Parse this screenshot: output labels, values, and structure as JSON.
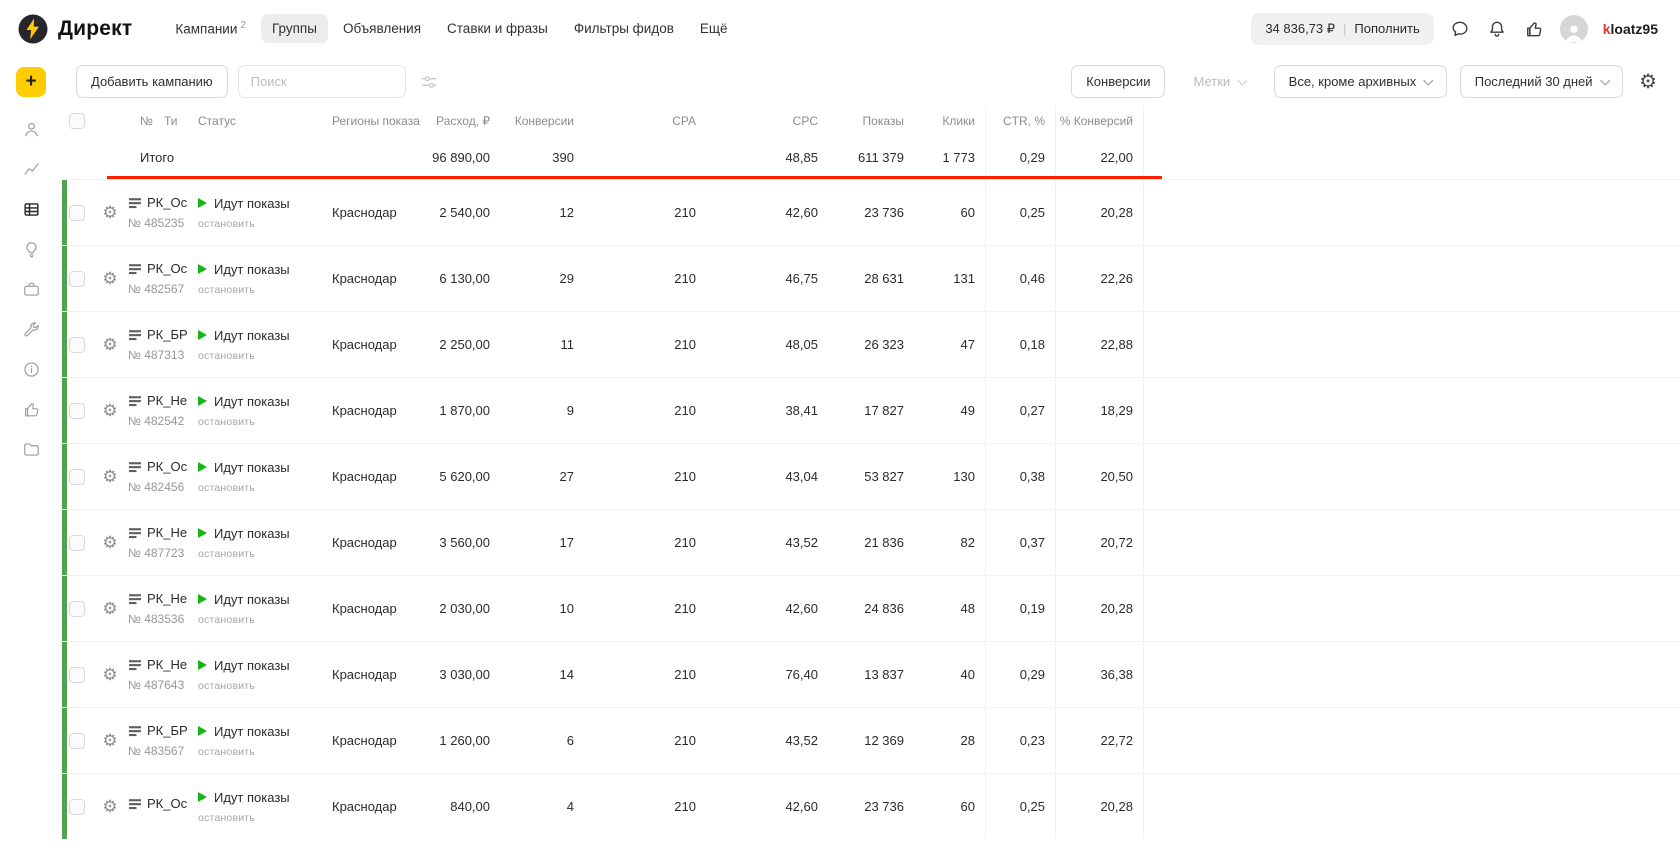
{
  "brand": {
    "app_name": "Директ"
  },
  "header": {
    "nav": [
      {
        "label": "Кампании",
        "badge": "2"
      },
      {
        "label": "Группы"
      },
      {
        "label": "Объявления"
      },
      {
        "label": "Ставки и фразы"
      },
      {
        "label": "Фильтры фидов"
      },
      {
        "label": "Ещё"
      }
    ],
    "balance": "34 836,73 ₽",
    "divider": "|",
    "topup": "Пополнить",
    "username_first": "k",
    "username_rest": "loatz95"
  },
  "sidebar": {
    "add": "+",
    "active_icon": "campaigns"
  },
  "toolbar": {
    "add_campaign": "Добавить кампанию",
    "search_placeholder": "Поиск",
    "conversions": "Конверсии",
    "labels": "Метки",
    "campaign_filter": "Все, кроме архивных",
    "date_range": "Последний 30 дней"
  },
  "table": {
    "headers": {
      "number": "№",
      "type": "Ти",
      "status": "Статус",
      "regions": "Регионы показа",
      "expense": "Расход, ₽",
      "conversions": "Конверсии",
      "cpa": "CPA",
      "cpc": "CPC",
      "shows": "Показы",
      "clicks": "Клики",
      "ctr": "CTR, %",
      "conv_share": "% Конверсий"
    },
    "totals": {
      "label": "Итого",
      "expense": "96 890,00",
      "conversions": "390",
      "cpa": "",
      "cpc": "48,85",
      "shows": "611 379",
      "clicks": "1 773",
      "ctr": "0,29",
      "conv_share": "22,00"
    },
    "rows": [
      {
        "name": "РК_Ос",
        "number": "№ 485235",
        "status": "Идут показы",
        "action": "остановить",
        "region": "Краснодар",
        "expense": "2 540,00",
        "conversions": "12",
        "cpa": "210",
        "cpc": "42,60",
        "shows": "23 736",
        "clicks": "60",
        "ctr": "0,25",
        "conv_share": "20,28"
      },
      {
        "name": "РК_Ос",
        "number": "№ 482567",
        "status": "Идут показы",
        "action": "остановить",
        "region": "Краснодар",
        "expense": "6 130,00",
        "conversions": "29",
        "cpa": "210",
        "cpc": "46,75",
        "shows": "28 631",
        "clicks": "131",
        "ctr": "0,46",
        "conv_share": "22,26"
      },
      {
        "name": "РК_БР",
        "number": "№ 487313",
        "status": "Идут показы",
        "action": "остановить",
        "region": "Краснодар",
        "expense": "2 250,00",
        "conversions": "11",
        "cpa": "210",
        "cpc": "48,05",
        "shows": "26 323",
        "clicks": "47",
        "ctr": "0,18",
        "conv_share": "22,88"
      },
      {
        "name": "РК_Не",
        "number": "№ 482542",
        "status": "Идут показы",
        "action": "остановить",
        "region": "Краснодар",
        "expense": "1 870,00",
        "conversions": "9",
        "cpa": "210",
        "cpc": "38,41",
        "shows": "17 827",
        "clicks": "49",
        "ctr": "0,27",
        "conv_share": "18,29"
      },
      {
        "name": "РК_Ос",
        "number": "№ 482456",
        "status": "Идут показы",
        "action": "остановить",
        "region": "Краснодар",
        "expense": "5 620,00",
        "conversions": "27",
        "cpa": "210",
        "cpc": "43,04",
        "shows": "53 827",
        "clicks": "130",
        "ctr": "0,38",
        "conv_share": "20,50"
      },
      {
        "name": "РК_Не",
        "number": "№ 487723",
        "status": "Идут показы",
        "action": "остановить",
        "region": "Краснодар",
        "expense": "3 560,00",
        "conversions": "17",
        "cpa": "210",
        "cpc": "43,52",
        "shows": "21 836",
        "clicks": "82",
        "ctr": "0,37",
        "conv_share": "20,72"
      },
      {
        "name": "РК_Не",
        "number": "№ 483536",
        "status": "Идут показы",
        "action": "остановить",
        "region": "Краснодар",
        "expense": "2 030,00",
        "conversions": "10",
        "cpa": "210",
        "cpc": "42,60",
        "shows": "24 836",
        "clicks": "48",
        "ctr": "0,19",
        "conv_share": "20,28"
      },
      {
        "name": "РК_Не",
        "number": "№ 487643",
        "status": "Идут показы",
        "action": "остановить",
        "region": "Краснодар",
        "expense": "3 030,00",
        "conversions": "14",
        "cpa": "210",
        "cpc": "76,40",
        "shows": "13 837",
        "clicks": "40",
        "ctr": "0,29",
        "conv_share": "36,38"
      },
      {
        "name": "РК_БР",
        "number": "№ 483567",
        "status": "Идут показы",
        "action": "остановить",
        "region": "Краснодар",
        "expense": "1 260,00",
        "conversions": "6",
        "cpa": "210",
        "cpc": "43,52",
        "shows": "12 369",
        "clicks": "28",
        "ctr": "0,23",
        "conv_share": "22,72"
      },
      {
        "name": "РК_Ос",
        "number": "",
        "status": "Идут показы",
        "action": "остановить",
        "region": "Краснодар",
        "expense": "840,00",
        "conversions": "4",
        "cpa": "210",
        "cpc": "42,60",
        "shows": "23 736",
        "clicks": "60",
        "ctr": "0,25",
        "conv_share": "20,28"
      }
    ]
  },
  "colors": {
    "accent": "#ffcc00",
    "status_green": "#17b317",
    "row_bar_green": "#55a154",
    "annotation_red": "#ff2000"
  }
}
